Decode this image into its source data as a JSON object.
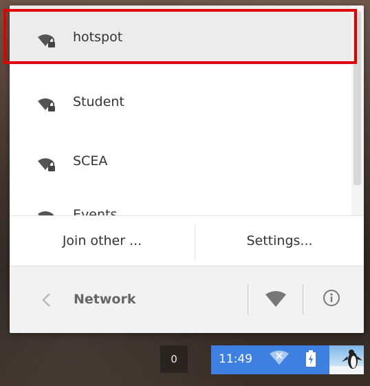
{
  "networks": [
    {
      "name": "hotspot",
      "icon": "wifi-locked-icon"
    },
    {
      "name": "Student",
      "icon": "wifi-locked-icon"
    },
    {
      "name": "SCEA",
      "icon": "wifi-locked-icon"
    },
    {
      "name": "Events",
      "icon": "wifi-locked-icon"
    }
  ],
  "actions": {
    "join_other": "Join other ...",
    "settings": "Settings..."
  },
  "footer": {
    "title": "Network",
    "back_icon": "chevron-left-icon",
    "wifi_icon": "wifi-icon",
    "info_icon": "info-icon"
  },
  "taskbar": {
    "notification_count": "0",
    "clock": "11:49",
    "wifi_icon": "wifi-disconnected-icon",
    "battery_icon": "battery-charging-icon"
  },
  "colors": {
    "highlight": "#e00000",
    "status_area": "#3d80e0",
    "selected_row": "#ececec"
  }
}
